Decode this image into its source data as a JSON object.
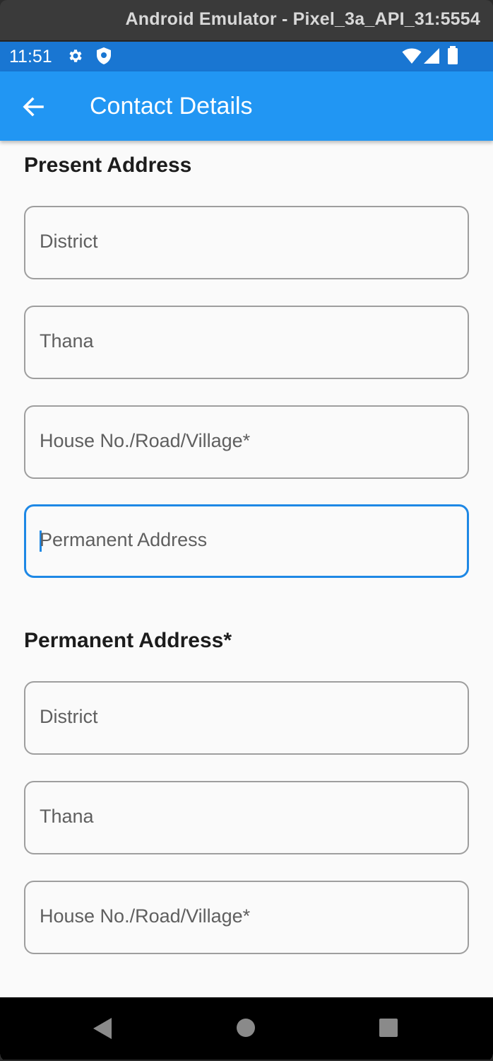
{
  "window": {
    "title": "Android Emulator - Pixel_3a_API_31:5554"
  },
  "statusbar": {
    "time": "11:51",
    "icons": [
      "gear-icon",
      "shield-icon",
      "wifi-icon",
      "signal-icon",
      "battery-icon"
    ]
  },
  "appbar": {
    "title": "Contact Details",
    "back_icon": "arrow-left-icon"
  },
  "present_address": {
    "heading": "Present Address",
    "fields": [
      {
        "placeholder": "District",
        "value": ""
      },
      {
        "placeholder": "Thana",
        "value": ""
      },
      {
        "placeholder": "House No./Road/Village*",
        "value": ""
      },
      {
        "placeholder": "Permanent Address",
        "value": "",
        "focused": true
      }
    ]
  },
  "permanent_address": {
    "heading": "Permanent Address*",
    "fields": [
      {
        "placeholder": "District",
        "value": ""
      },
      {
        "placeholder": "Thana",
        "value": ""
      },
      {
        "placeholder": "House No./Road/Village*",
        "value": ""
      }
    ]
  },
  "navbar": {
    "icons": [
      "nav-back-icon",
      "nav-home-icon",
      "nav-recents-icon"
    ]
  },
  "colors": {
    "status_bar": "#1976d2",
    "app_bar": "#2196f3",
    "focus_border": "#1e88e5",
    "field_border": "#9e9e9e",
    "background": "#fafafa"
  }
}
